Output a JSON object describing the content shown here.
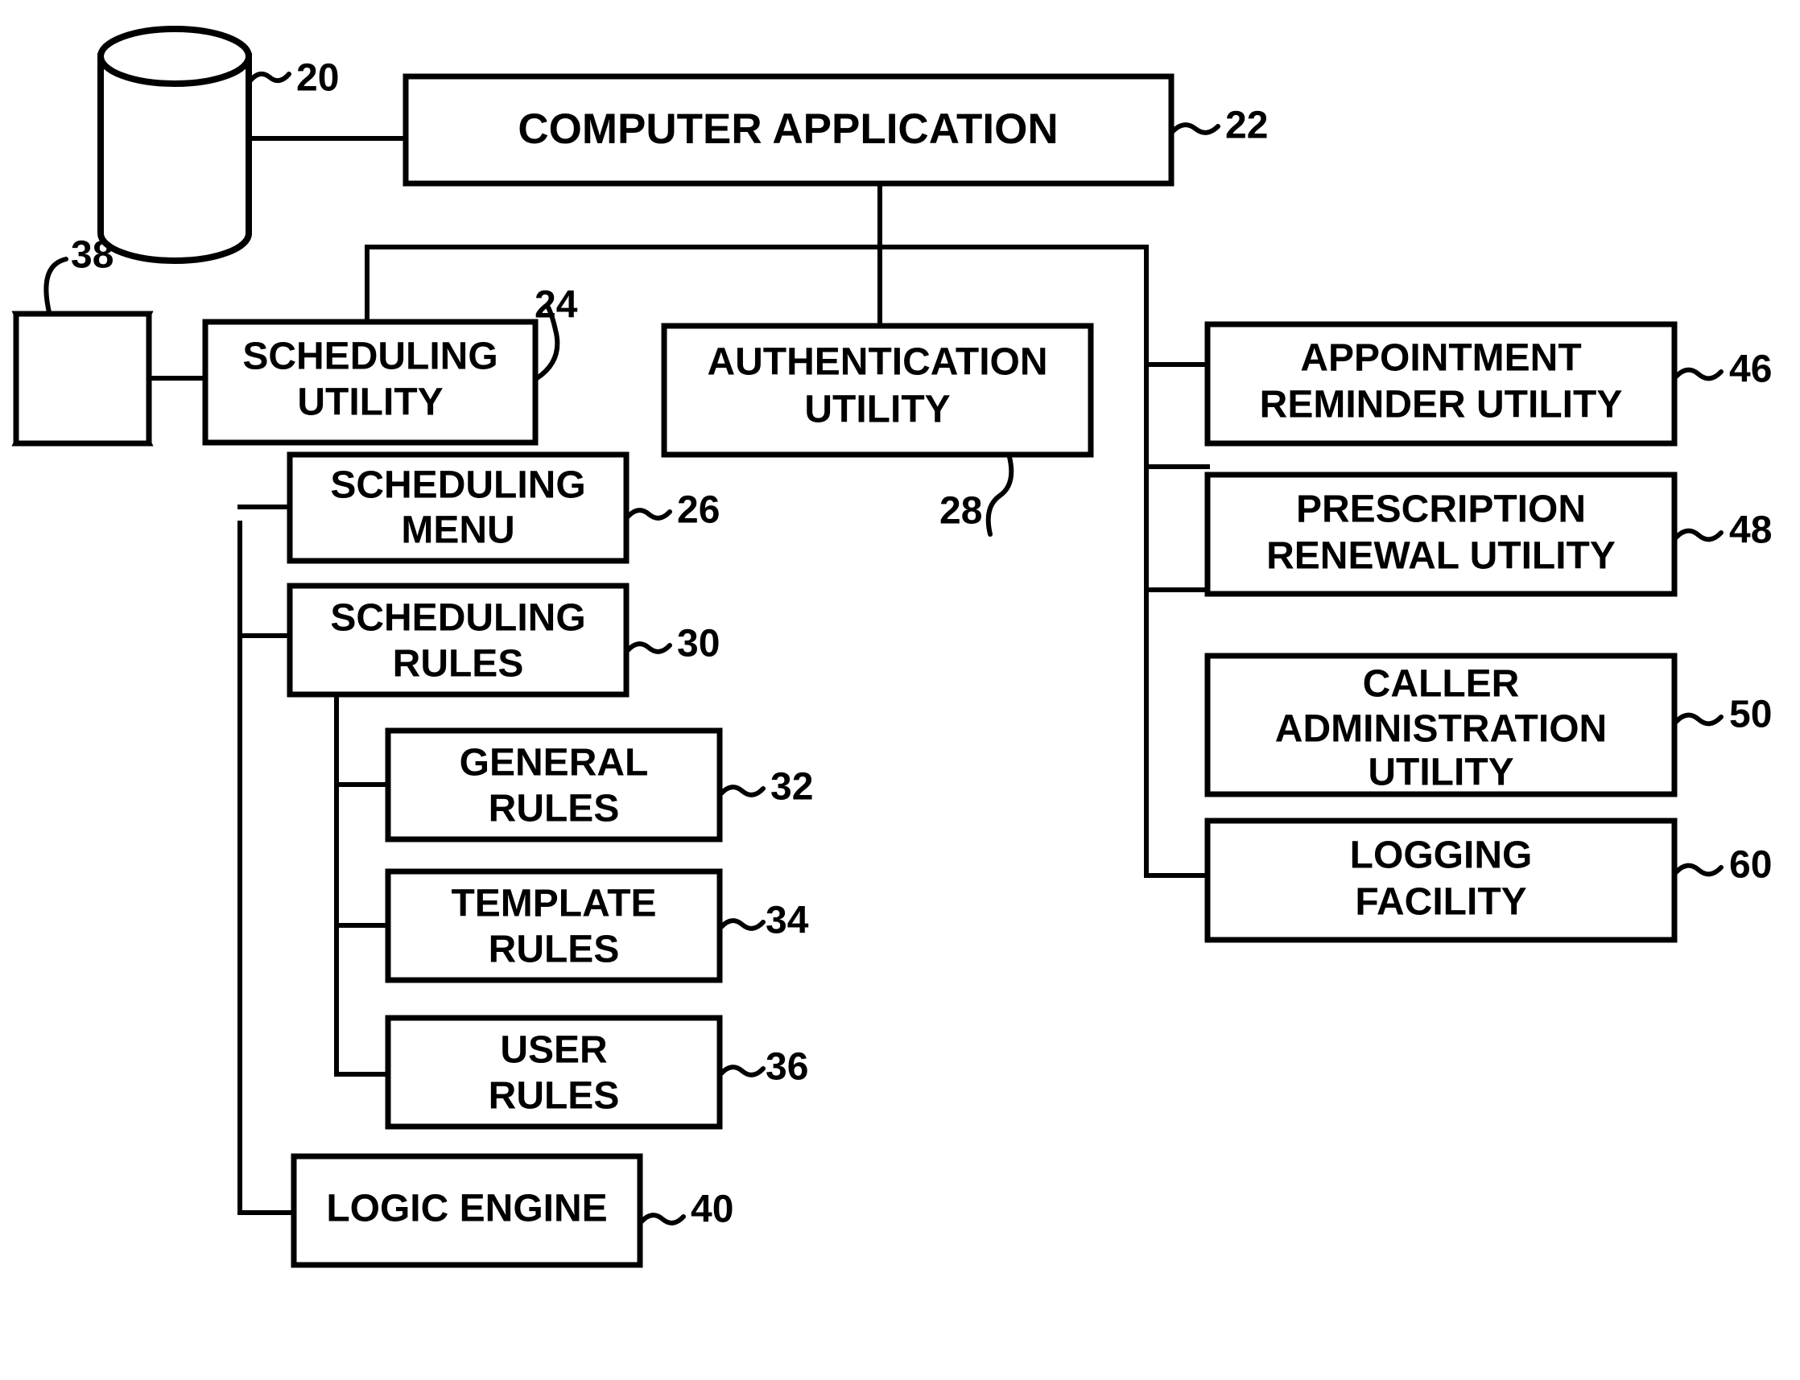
{
  "figure": {
    "title": "Computer application scheduling system block diagram",
    "style": "patent line drawing, black on white"
  },
  "colors": {
    "line": "#000000",
    "fill": "#ffffff"
  },
  "nodes": {
    "database": {
      "ref": "20",
      "shape": "cylinder",
      "label": ""
    },
    "computer_application": {
      "ref": "22",
      "line1": "COMPUTER APPLICATION",
      "line2": ""
    },
    "scheduling_utility": {
      "ref": "24",
      "line1": "SCHEDULING",
      "line2": "UTILITY"
    },
    "scheduling_menu": {
      "ref": "26",
      "line1": "SCHEDULING",
      "line2": "MENU"
    },
    "authentication_utility": {
      "ref": "28",
      "line1": "AUTHENTICATION",
      "line2": "UTILITY"
    },
    "scheduling_rules": {
      "ref": "30",
      "line1": "SCHEDULING",
      "line2": "RULES"
    },
    "general_rules": {
      "ref": "32",
      "line1": "GENERAL",
      "line2": "RULES"
    },
    "template_rules": {
      "ref": "34",
      "line1": "TEMPLATE",
      "line2": "RULES"
    },
    "user_rules": {
      "ref": "36",
      "line1": "USER",
      "line2": "RULES"
    },
    "telephone": {
      "ref": "38",
      "shape": "concave-rectangle",
      "label": ""
    },
    "logic_engine": {
      "ref": "40",
      "line1": "LOGIC ENGINE",
      "line2": ""
    },
    "appointment_reminder_utility": {
      "ref": "46",
      "line1": "APPOINTMENT",
      "line2": "REMINDER UTILITY"
    },
    "prescription_renewal_utility": {
      "ref": "48",
      "line1": "PRESCRIPTION",
      "line2": "RENEWAL UTILITY"
    },
    "caller_administration_utility": {
      "ref": "50",
      "line1": "CALLER",
      "line2": "ADMINISTRATION",
      "line3": "UTILITY"
    },
    "logging_facility": {
      "ref": "60",
      "line1": "LOGGING",
      "line2": "FACILITY"
    }
  },
  "reference_numerals": [
    "20",
    "22",
    "24",
    "26",
    "28",
    "30",
    "32",
    "34",
    "36",
    "38",
    "40",
    "46",
    "48",
    "50",
    "60"
  ]
}
